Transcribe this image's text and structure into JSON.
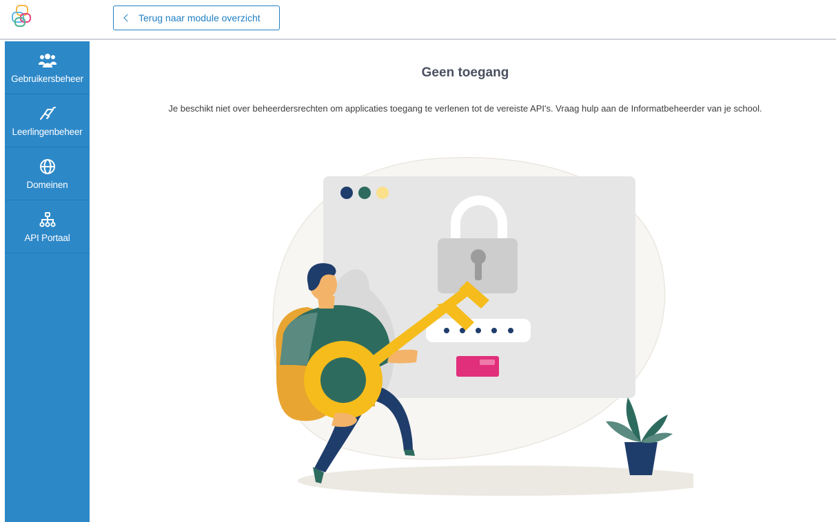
{
  "header": {
    "back_label": "Terug naar module overzicht"
  },
  "sidebar": {
    "items": [
      {
        "label": "Gebruikersbeheer",
        "icon": "users-icon"
      },
      {
        "label": "Leerlingenbeheer",
        "icon": "handshake-icon"
      },
      {
        "label": "Domeinen",
        "icon": "globe-icon"
      },
      {
        "label": "API Portaal",
        "icon": "sitemap-icon"
      }
    ]
  },
  "main": {
    "title": "Geen toegang",
    "description": "Je beschikt niet over beheerdersrechten om applicaties toegang te verlenen tot de vereiste API's. Vraag hulp aan de Informatbeheerder van je school."
  },
  "colors": {
    "sidebar": "#2d88c8",
    "accent": "#2180c3",
    "key": "#f5bc1c",
    "shirt": "#2e6b5f",
    "lock_button": "#e12f7b"
  }
}
